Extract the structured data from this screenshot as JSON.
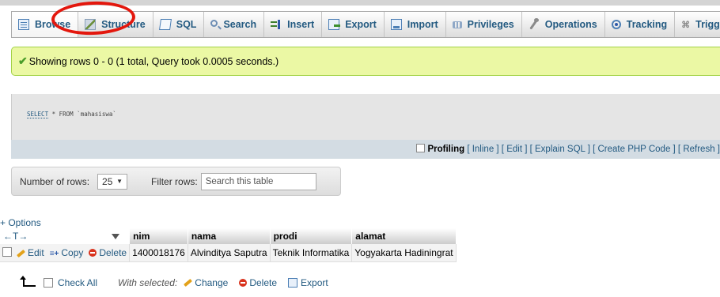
{
  "tabs": [
    {
      "label": "Browse",
      "icon": "browse-icon"
    },
    {
      "label": "Structure",
      "icon": "structure-icon"
    },
    {
      "label": "SQL",
      "icon": "sql-icon"
    },
    {
      "label": "Search",
      "icon": "search-icon"
    },
    {
      "label": "Insert",
      "icon": "insert-icon"
    },
    {
      "label": "Export",
      "icon": "export-icon"
    },
    {
      "label": "Import",
      "icon": "import-icon"
    },
    {
      "label": "Privileges",
      "icon": "privileges-icon"
    },
    {
      "label": "Operations",
      "icon": "operations-icon"
    },
    {
      "label": "Tracking",
      "icon": "tracking-icon"
    },
    {
      "label": "Triggers",
      "icon": "triggers-icon"
    }
  ],
  "success_message": "Showing rows 0 - 0 (1 total, Query took 0.0005 seconds.)",
  "sql": {
    "keyword": "SELECT",
    "rest": " * FROM `mahasiswa`"
  },
  "sql_links": {
    "profiling_label": "Profiling",
    "inline": "Inline",
    "edit": "Edit",
    "explain": "Explain SQL",
    "create_php": "Create PHP Code",
    "refresh": "Refresh"
  },
  "navigation": {
    "rows_label": "Number of rows:",
    "rows_value": "25",
    "filter_label": "Filter rows:",
    "filter_placeholder": "Search this table"
  },
  "options_link": "+ Options",
  "table": {
    "arrows": "←T→",
    "columns": [
      "nim",
      "nama",
      "prodi",
      "alamat"
    ],
    "actions": {
      "edit": "Edit",
      "copy": "Copy",
      "delete": "Delete"
    },
    "rows": [
      [
        "1400018176",
        "Alvinditya Saputra",
        "Teknik Informatika",
        "Yogyakarta Hadiningrat"
      ]
    ]
  },
  "bulk": {
    "check_all": "Check All",
    "with_selected": "With selected:",
    "change": "Change",
    "delete": "Delete",
    "export": "Export"
  },
  "colors": {
    "accent": "#235a81",
    "success_bg": "#ebf8a4",
    "annotation_circle": "#e3170d"
  }
}
